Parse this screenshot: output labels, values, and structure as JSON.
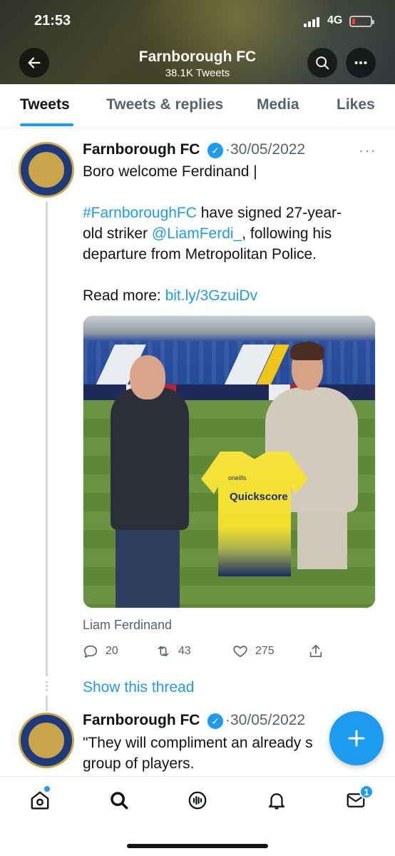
{
  "status_bar": {
    "time": "21:53",
    "network": "4G"
  },
  "header": {
    "title": "Farnborough FC",
    "subtitle": "38.1K Tweets"
  },
  "tabs": [
    {
      "label": "Tweets",
      "active": true
    },
    {
      "label": "Tweets & replies",
      "active": false
    },
    {
      "label": "Media",
      "active": false
    },
    {
      "label": "Likes",
      "active": false
    }
  ],
  "tweets": [
    {
      "author": "Farnborough FC",
      "date": "30/05/2022",
      "lines": {
        "l1": "Boro welcome Ferdinand |",
        "hashtag": "#FarnboroughFC",
        "l2_rest": " have signed 27-year-",
        "l3_pre": "old striker ",
        "mention": "@LiamFerdi_",
        "l3_rest": ", following his",
        "l4": "departure from Metropolitan Police.",
        "l5_pre": "Read more: ",
        "url": "bit.ly/3GzuiDv"
      },
      "photo": {
        "jersey_brand": "oneills",
        "jersey_sponsor": "Quickscore"
      },
      "media_caption": "Liam Ferdinand",
      "stats": {
        "replies": "20",
        "retweets": "43",
        "likes": "275"
      },
      "show_thread": "Show this thread"
    },
    {
      "author": "Farnborough FC",
      "date": "30/05/2022",
      "lines": {
        "l1": "\"They will compliment an already s",
        "l2": "group of players."
      }
    }
  ],
  "bottom_nav": {
    "messages_badge": "1"
  },
  "colors": {
    "accent": "#1d9bf0",
    "text": "#0f1419",
    "muted": "#536471"
  }
}
